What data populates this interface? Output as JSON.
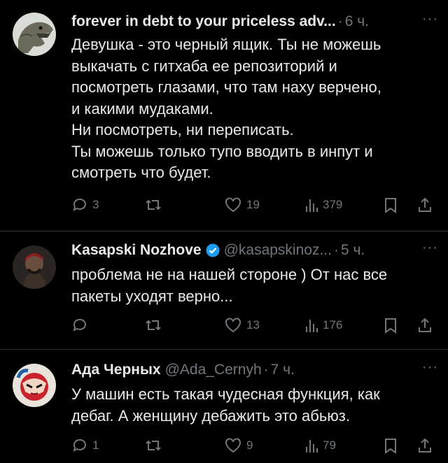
{
  "tweets": [
    {
      "name": "forever in debt to your priceless adv...",
      "handle": "",
      "time": "6 ч.",
      "verified": false,
      "text": "Девушка - это черный ящик. Ты не можешь\nвыкачать с гитхаба ее репозиторий и\nпосмотреть глазами, что там наху верчено,\nи какими мудаками.\nНи посмотреть, ни переписать.\nТы можешь только тупо вводить в инпут и\nсмотреть что будет.",
      "replies": "3",
      "retweets": "",
      "likes": "19",
      "views": "379"
    },
    {
      "name": "Kasapski Nozhove",
      "handle": "@kasapskinoz...",
      "time": "5 ч.",
      "verified": true,
      "text": "проблема не на нашей стороне ) От нас все\nпакеты уходят верно...",
      "replies": "",
      "retweets": "",
      "likes": "13",
      "views": "176"
    },
    {
      "name": "Ада Черных",
      "handle": "@Ada_Cernyh",
      "time": "7 ч.",
      "verified": false,
      "text": "У машин есть такая чудесная функция, как\nдебаг. А женщину дебажить это абьюз.",
      "replies": "1",
      "retweets": "",
      "likes": "9",
      "views": "79"
    }
  ],
  "more_label": "···",
  "dot": "·",
  "icons": {
    "reply": "reply-icon",
    "retweet": "retweet-icon",
    "like": "heart-icon",
    "views": "views-icon",
    "bookmark": "bookmark-icon",
    "share": "share-icon"
  },
  "colors": {
    "background": "#000000",
    "text": "#e7e9ea",
    "muted": "#71767b",
    "divider": "#2f3336",
    "verified": "#1d9bf0"
  }
}
